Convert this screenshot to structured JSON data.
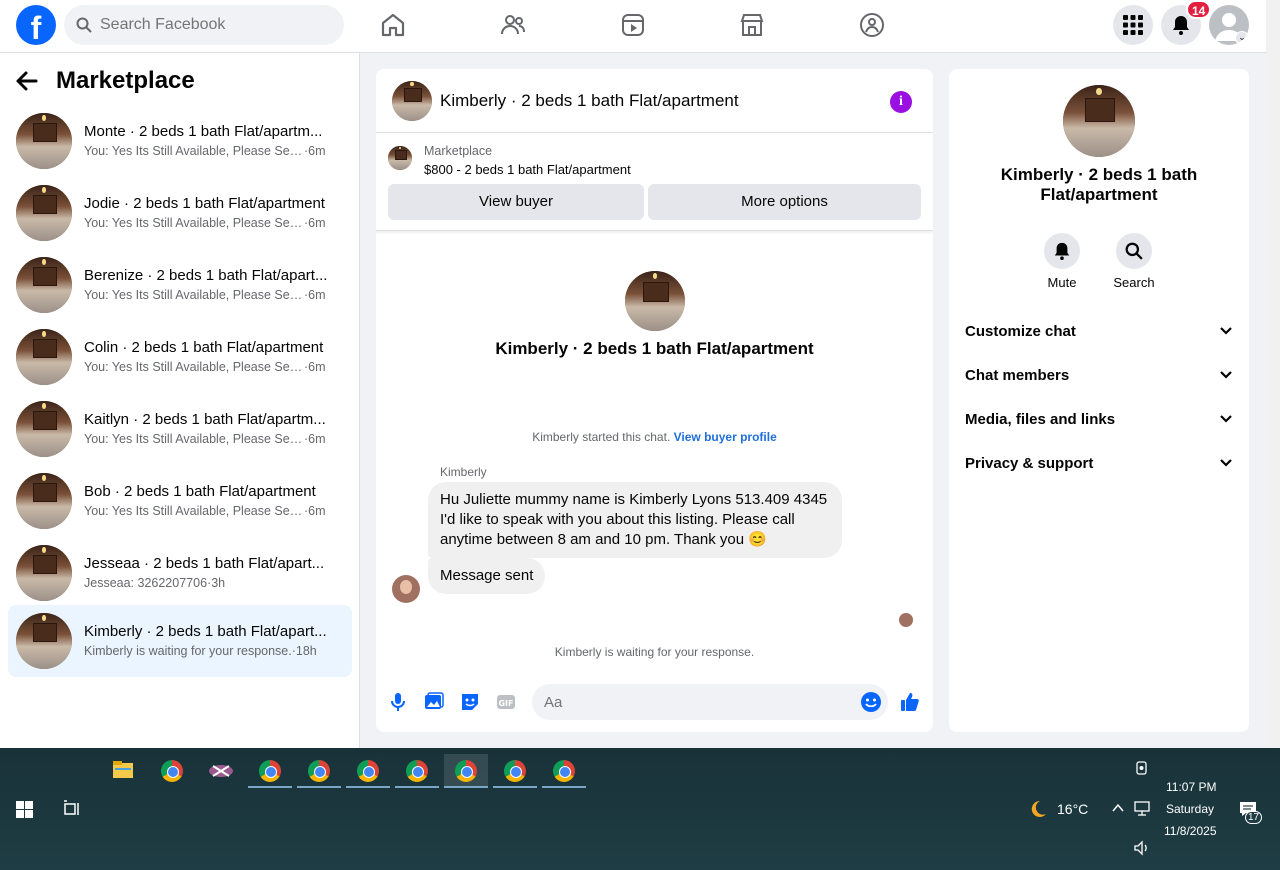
{
  "topbar": {
    "logo": "f",
    "search_placeholder": "Search Facebook",
    "notifications_count": "14",
    "nav_icons": [
      "home-icon",
      "friends-icon",
      "video-icon",
      "marketplace-icon",
      "groups-icon"
    ]
  },
  "sidebar": {
    "title": "Marketplace",
    "conversations": [
      {
        "title": "Monte · 2 beds 1 bath Flat/apartm...",
        "message": "You: Yes Its Still Available, Please Sen...",
        "time": "·6m"
      },
      {
        "title": "Jodie · 2 beds 1 bath Flat/apartment",
        "message": "You: Yes Its Still Available, Please Sen...",
        "time": "·6m"
      },
      {
        "title": "Berenize · 2 beds 1 bath Flat/apart...",
        "message": "You: Yes Its Still Available, Please Sen...",
        "time": "·6m"
      },
      {
        "title": "Colin · 2 beds 1 bath Flat/apartment",
        "message": "You: Yes Its Still Available, Please Sen...",
        "time": "·6m"
      },
      {
        "title": "Kaitlyn · 2 beds 1 bath Flat/apartm...",
        "message": "You: Yes Its Still Available, Please Sen...",
        "time": "·6m"
      },
      {
        "title": "Bob · 2 beds 1 bath Flat/apartment",
        "message": "You: Yes Its Still Available, Please Sen...",
        "time": "·6m"
      },
      {
        "title": "Jesseaa · 2 beds 1 bath Flat/apart...",
        "message": "Jesseaa: 3262207706",
        "time": "·3h"
      },
      {
        "title": "Kimberly · 2 beds 1 bath Flat/apart...",
        "message": "Kimberly is waiting for your response.",
        "time": "·18h"
      }
    ]
  },
  "chat": {
    "header_title": "Kimberly · 2 beds 1 bath Flat/apartment",
    "listing_source": "Marketplace",
    "listing_title": "$800 - 2 beds 1 bath Flat/apartment",
    "view_buyer": "View buyer",
    "more_options": "More options",
    "center_title": "Kimberly · 2 beds 1 bath Flat/apartment",
    "started_text": "Kimberly started this chat.",
    "view_buyer_profile": "View buyer profile",
    "sender_name": "Kimberly",
    "message_1": "Hu Juliette mummy name is Kimberly Lyons 513.409 4345 I'd like to speak with you about this listing.  Please call anytime between 8 am and 10 pm. Thank you 😊",
    "message_2": "Message sent",
    "waiting_text": "Kimberly is waiting for your response.",
    "input_placeholder": "Aa"
  },
  "details": {
    "title": "Kimberly · 2 beds 1 bath Flat/apartment",
    "mute": "Mute",
    "search": "Search",
    "sections": [
      "Customize chat",
      "Chat members",
      "Media, files and links",
      "Privacy & support"
    ]
  },
  "taskbar": {
    "weather": "16°C",
    "time": "11:07 PM",
    "day": "Saturday",
    "date": "11/8/2025",
    "notification_count": "17"
  }
}
